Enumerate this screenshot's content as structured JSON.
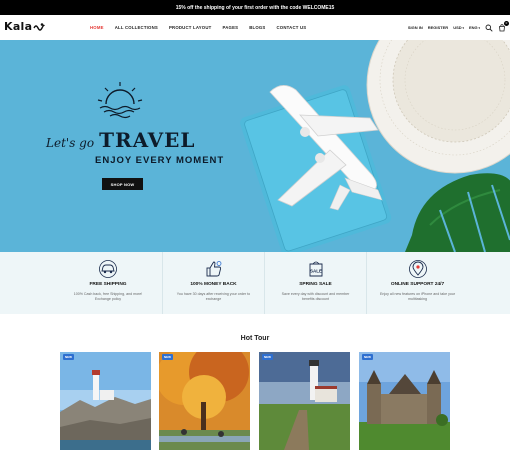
{
  "topbar": {
    "text": "15% off the shipping of your first order with the code WELCOME15"
  },
  "header": {
    "logo": "Kala",
    "nav": [
      {
        "label": "HOME",
        "active": true
      },
      {
        "label": "ALL COLLECTIONS"
      },
      {
        "label": "PRODUCT LAYOUT"
      },
      {
        "label": "PAGES"
      },
      {
        "label": "BLOGS"
      },
      {
        "label": "CONTACT US"
      }
    ],
    "sign_in": "SIGN IN",
    "register": "REGISTER",
    "currency": "USD",
    "language": "ENG",
    "cart_count": "0",
    "icons": [
      "search-icon",
      "cart-icon"
    ]
  },
  "hero": {
    "script": "Let's go",
    "title": "TRAVEL",
    "subtitle": "ENJOY EVERY MOMENT",
    "button": "SHOP NOW",
    "background": "#5bb4d8"
  },
  "features": [
    {
      "icon": "car-icon",
      "title": "FREE SHIPPING",
      "desc": "100% Cash back, free Shipping, and more! Exchange policy"
    },
    {
      "icon": "thumbs-up-icon",
      "title": "100% MONEY BACK",
      "desc": "You have 30 days after receiving your order to exchange"
    },
    {
      "icon": "sale-tag-icon",
      "title": "SPRING SALE",
      "desc": "Save every day with discount and member benefits discount"
    },
    {
      "icon": "location-pin-icon",
      "title": "ONLINE SUPPORT 24/7",
      "desc": "Enjoy all new features on iPhone and take your multitasking"
    }
  ],
  "hot_tour": {
    "title": "Hot Tour",
    "cards": [
      {
        "badge": "NEW"
      },
      {
        "badge": "NEW"
      },
      {
        "badge": "NEW"
      },
      {
        "badge": "NEW"
      }
    ]
  }
}
